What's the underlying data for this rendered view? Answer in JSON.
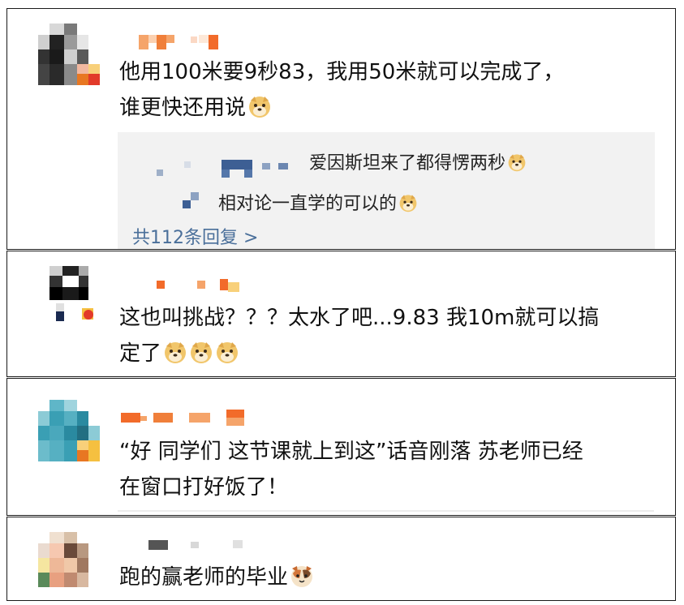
{
  "comments": [
    {
      "line1": "他用100米要9秒83，我用50米就可以完成了，",
      "line2": "谁更快还用说",
      "replies": [
        {
          "text": "爱因斯坦来了都得愣两秒"
        },
        {
          "text": "相对论一直学的可以的"
        }
      ],
      "more_replies": "共112条回复 >"
    },
    {
      "line1": "这也叫挑战？？？太水了吧...9.83 我10m就可以搞",
      "line2": "定了"
    },
    {
      "line1": "“好 同学们 这节课就上到这”话音刚落 苏老师已经",
      "line2": "在窗口打好饭了！"
    },
    {
      "line1": "跑的赢老师的毕业"
    }
  ],
  "emoji": {
    "doge": "doge-emoji",
    "cat": "cat-emoji"
  },
  "colors": {
    "link": "#4a6f9a",
    "reply_bg": "#f2f2f2",
    "border": "#1a1a1a"
  }
}
